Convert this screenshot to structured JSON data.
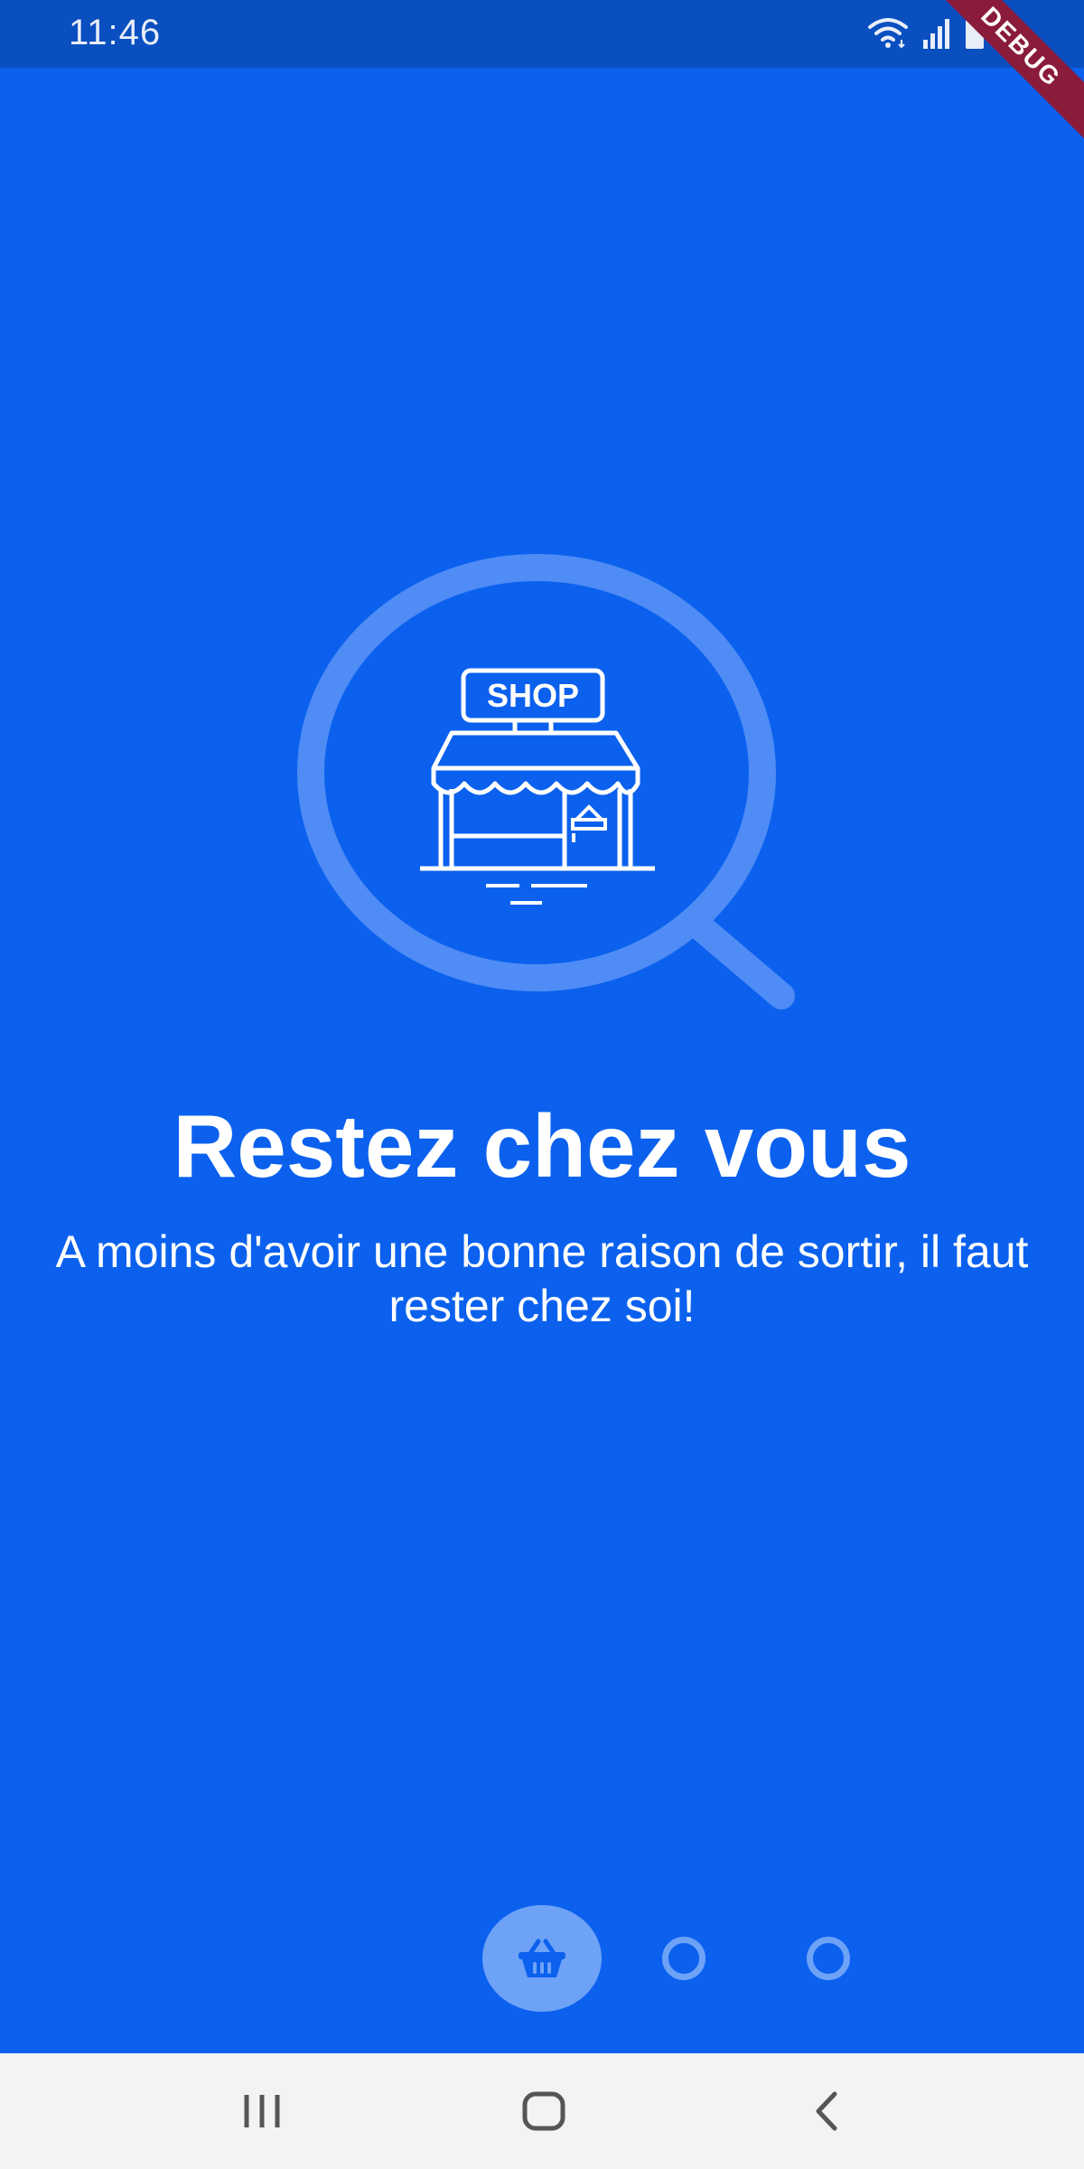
{
  "status_bar": {
    "time": "11:46",
    "icons": [
      "wifi-icon",
      "signal-icon",
      "battery-icon"
    ]
  },
  "debug_banner": {
    "label": "DEBUG"
  },
  "illustration": {
    "icon": "search-shop-icon",
    "sign_text": "SHOP"
  },
  "onboarding": {
    "title": "Restez chez vous",
    "subtitle": "A moins d'avoir une bonne raison de sortir, il faut rester chez soi!"
  },
  "pager": {
    "current_page": 1,
    "total_pages": 3,
    "active_icon": "basket-icon"
  },
  "nav_bar": {
    "buttons": [
      "recent-apps-icon",
      "home-icon",
      "back-icon"
    ]
  },
  "colors": {
    "background": "#0B61EE",
    "status_bar": "#0A4FC0",
    "indicator": "#6EA2F7",
    "nav_bar": "#F3F3F3",
    "debug_ribbon": "#8A1B3A"
  }
}
